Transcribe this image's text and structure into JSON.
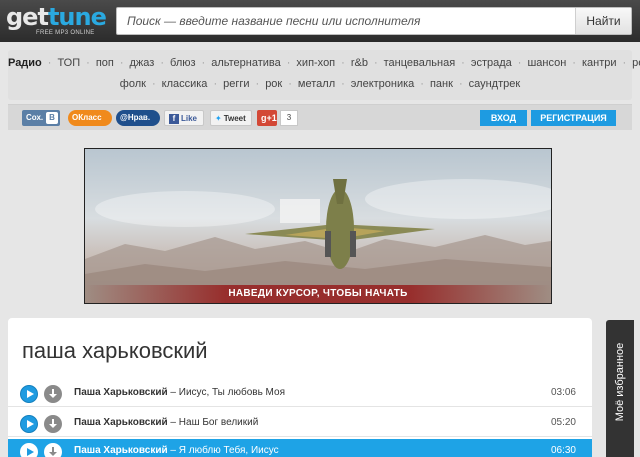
{
  "header": {
    "logo_part1": "get",
    "logo_part2": "tune",
    "logo_sub": "FREE MP3 ONLINE",
    "search_placeholder": "Поиск — введите название песни или исполнителя",
    "search_button": "Найти"
  },
  "genres": {
    "row1": [
      "Радио",
      "ТОП",
      "поп",
      "джаз",
      "блюз",
      "альтернатива",
      "хип-хоп",
      "r&b",
      "танцевальная",
      "эстрада",
      "шансон",
      "кантри",
      "релакс"
    ],
    "row2": [
      "фолк",
      "классика",
      "регги",
      "рок",
      "металл",
      "электроника",
      "панк",
      "саундтрек"
    ],
    "active": "Радио"
  },
  "social": {
    "vk_label": "Сох.",
    "vk_icon": "В",
    "ok_label": "Класс",
    "mail_label": "Нрав.",
    "fb_label": "Like",
    "tw_label": "Tweet",
    "gplus_label": "+1",
    "gplus_count": "3"
  },
  "auth": {
    "login": "ВХОД",
    "register": "РЕГИСТРАЦИЯ"
  },
  "banner": {
    "cta": "НАВЕДИ КУРСОР, ЧТОБЫ НАЧАТЬ"
  },
  "main": {
    "title": "паша харьковский",
    "tracks": [
      {
        "artist": "Паша Харьковский",
        "song": "Иисус, Ты любовь Моя",
        "duration": "03:06"
      },
      {
        "artist": "Паша Харьковский",
        "song": "Наш Бог великий",
        "duration": "05:20"
      },
      {
        "artist": "Паша Харьковский",
        "song": "Я люблю Тебя, Иисус",
        "duration": "06:30"
      }
    ],
    "separator": " – "
  },
  "sidebar": {
    "favorites": "Моё избранное"
  },
  "colors": {
    "accent": "#1e9be1",
    "header_bg": "#2c2c2c",
    "active_row": "#1ea3e6"
  }
}
